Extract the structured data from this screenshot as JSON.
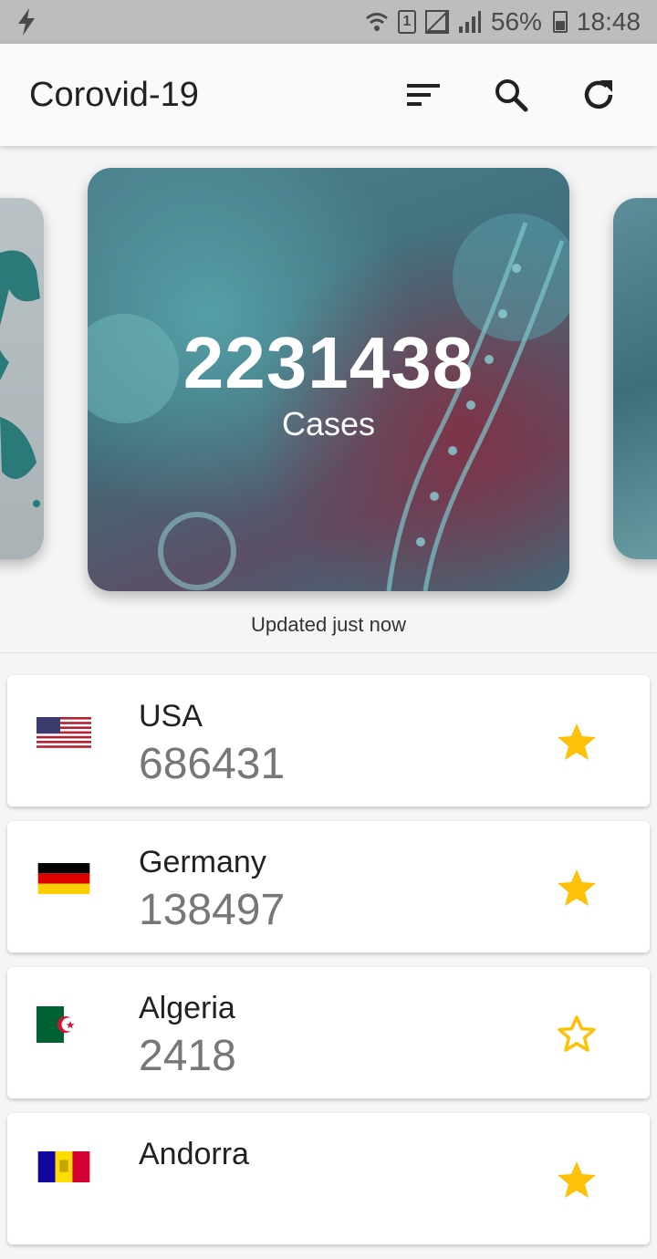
{
  "status_bar": {
    "battery": "56%",
    "time": "18:48",
    "sim": "1"
  },
  "app_bar": {
    "title": "Corovid-19",
    "icons": [
      "sort-icon",
      "search-icon",
      "refresh-icon"
    ]
  },
  "hero": {
    "value": "2231438",
    "label": "Cases",
    "updated": "Updated just now"
  },
  "countries": [
    {
      "name": "USA",
      "cases": "686431",
      "favorite": true,
      "flag": "usa-flag"
    },
    {
      "name": "Germany",
      "cases": "138497",
      "favorite": true,
      "flag": "germany-flag"
    },
    {
      "name": "Algeria",
      "cases": "2418",
      "favorite": false,
      "flag": "algeria-flag"
    },
    {
      "name": "Andorra",
      "cases": "",
      "favorite": true,
      "flag": "andorra-flag"
    }
  ],
  "colors": {
    "star": "#ffc107",
    "status_bar": "#bdbdbd",
    "app_bar": "#fafafa"
  }
}
